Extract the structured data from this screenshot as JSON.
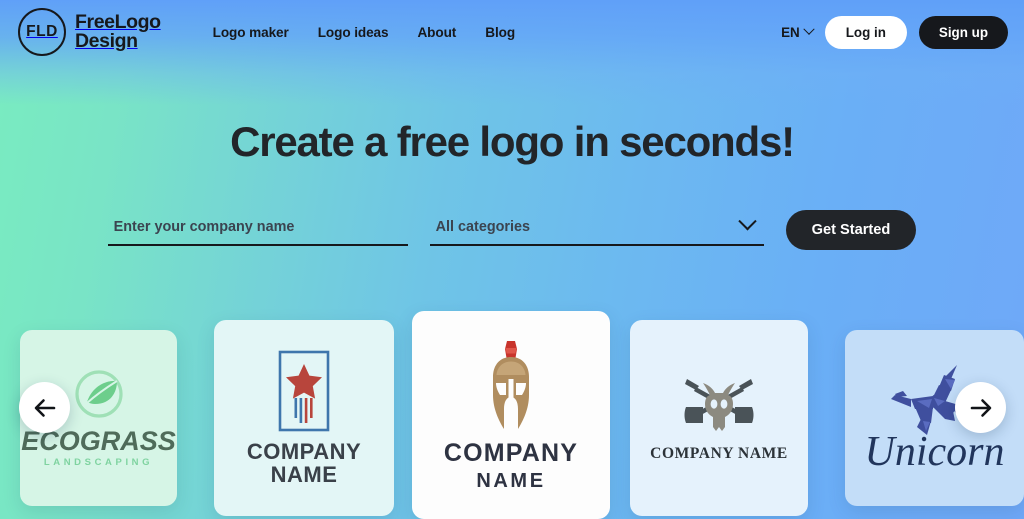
{
  "brand": {
    "mark_text": "FLD",
    "name_line1": "FreeLogo",
    "name_line2": "Design",
    "mark_icon": "circle-monogram-icon"
  },
  "nav": {
    "items": [
      {
        "label": "Logo maker"
      },
      {
        "label": "Logo ideas"
      },
      {
        "label": "About"
      },
      {
        "label": "Blog"
      }
    ]
  },
  "header_right": {
    "language": "EN",
    "language_chevron_icon": "chevron-down-icon",
    "login_label": "Log in",
    "signup_label": "Sign up"
  },
  "hero": {
    "title": "Create a free logo in seconds!"
  },
  "search": {
    "company_placeholder": "Enter your company name",
    "company_value": "",
    "category_selected": "All categories",
    "category_chevron_icon": "chevron-down-icon",
    "cta_label": "Get Started"
  },
  "carousel": {
    "prev_icon": "arrow-left-icon",
    "next_icon": "arrow-right-icon",
    "cards": [
      {
        "id": "ecograss",
        "icon": "leaf-circle-icon",
        "name": "ECOGRASS",
        "tagline": "LANDSCAPING",
        "bg": "#d6f5e6",
        "text_color": "#4f6b5a",
        "accent": "#7fd89a"
      },
      {
        "id": "star-stripes",
        "icon": "star-stripes-frame-icon",
        "name_line1": "COMPANY",
        "name_line2": "NAME",
        "bg": "#e3f6f6",
        "text_color": "#3a4149",
        "accent": "#b8453c",
        "frame_color": "#3f76ac"
      },
      {
        "id": "spartan-helmet",
        "icon": "spartan-helmet-icon",
        "name_line1": "COMPANY",
        "name_line2": "NAME",
        "bg": "#fdfdfd",
        "text_color": "#2e3342",
        "accent": "#b08d5f",
        "crest_color": "#c8342c"
      },
      {
        "id": "bull-skull",
        "icon": "bull-skull-arrows-icon",
        "name": "COMPANY NAME",
        "bg": "#e5f2fc",
        "text_color": "#2c3338",
        "accent": "#8c8a80",
        "arrow_color": "#4a5358"
      },
      {
        "id": "unicorn",
        "icon": "geometric-unicorn-icon",
        "name": "Unicorn",
        "bg": "#c3ddf8",
        "text_color": "#21355c",
        "accent": "#3f4f9e"
      }
    ]
  },
  "colors": {
    "gradient_start": "#79ecc0",
    "gradient_end": "#6fa8f8",
    "dark": "#16181c",
    "white": "#ffffff"
  }
}
